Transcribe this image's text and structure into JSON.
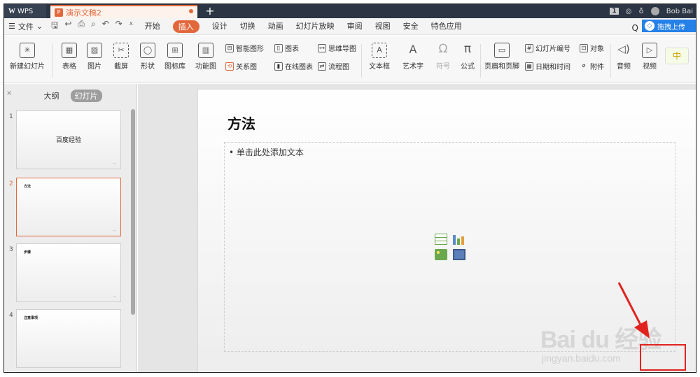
{
  "titlebar": {
    "app_name": "WPS",
    "doc_tab": "演示文稿2",
    "new_tab": "+",
    "badge": "1",
    "user": "Bob Bai"
  },
  "menubar": {
    "file": "文件",
    "tabs": [
      "开始",
      "插入",
      "设计",
      "切换",
      "动画",
      "幻灯片放映",
      "审阅",
      "视图",
      "安全",
      "特色应用"
    ],
    "active_tab": "插入",
    "cloud_label": "拖拽上传"
  },
  "ribbon": {
    "new_slide": "新建幻灯片",
    "table": "表格",
    "picture": "图片",
    "screenshot": "截屏",
    "shape": "形状",
    "icon_library": "图标库",
    "function_chart": "功能图",
    "smart_shape": "智能图形",
    "chart": "图表",
    "mind_map": "思维导图",
    "relation_chart": "关系图",
    "online_chart": "在线图表",
    "flowchart": "流程图",
    "textbox": "文本框",
    "wordart": "艺术字",
    "symbol": "符号",
    "formula": "公式",
    "header_footer": "页眉和页脚",
    "slide_number": "幻灯片编号",
    "object": "对象",
    "date_time": "日期和时间",
    "attachment": "附件",
    "audio": "音频",
    "video": "视频",
    "ime": "中"
  },
  "leftpanel": {
    "outline_tab": "大纲",
    "slides_tab": "幻灯片",
    "slides": [
      {
        "num": "1",
        "title": "百度经验"
      },
      {
        "num": "2",
        "title": "方法"
      },
      {
        "num": "3",
        "title": "步骤"
      },
      {
        "num": "4",
        "title": "注意事项"
      }
    ]
  },
  "slide": {
    "title": "方法",
    "placeholder": "单击此处添加文本"
  },
  "watermark": {
    "brand": "Bai du 经验",
    "url": "jingyan.baidu.com"
  },
  "colors": {
    "accent": "#e2683c",
    "titlebar": "#2b3544",
    "cloud": "#2580e8",
    "annotation": "#e0231f"
  }
}
